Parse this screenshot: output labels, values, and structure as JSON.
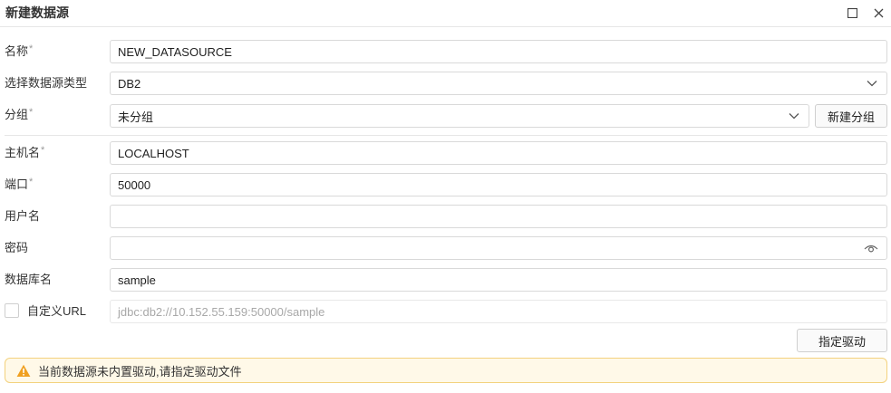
{
  "dialog": {
    "title": "新建数据源",
    "maximize_icon": "maximize-icon",
    "close_icon": "close-icon"
  },
  "form": {
    "name": {
      "label": "名称",
      "required": "*",
      "value": "NEW_DATASOURCE"
    },
    "type": {
      "label": "选择数据源类型",
      "value": "DB2"
    },
    "group": {
      "label": "分组",
      "required": "*",
      "value": "未分组",
      "new_group_button": "新建分组"
    },
    "host": {
      "label": "主机名",
      "required": "*",
      "value": "LOCALHOST"
    },
    "port": {
      "label": "端口",
      "required": "*",
      "value": "50000"
    },
    "username": {
      "label": "用户名",
      "value": ""
    },
    "password": {
      "label": "密码",
      "value": "",
      "eye_icon": "eye-icon"
    },
    "database": {
      "label": "数据库名",
      "value": "sample"
    },
    "custom_url": {
      "label": "自定义URL",
      "checked": false,
      "value": "jdbc:db2://10.152.55.159:50000/sample"
    }
  },
  "actions": {
    "specify_driver": "指定驱动"
  },
  "alert": {
    "icon": "warning-icon",
    "text": "当前数据源未内置驱动,请指定驱动文件",
    "color": "#fff9e8",
    "border_color": "#f3d27e",
    "icon_color": "#f0a020"
  }
}
